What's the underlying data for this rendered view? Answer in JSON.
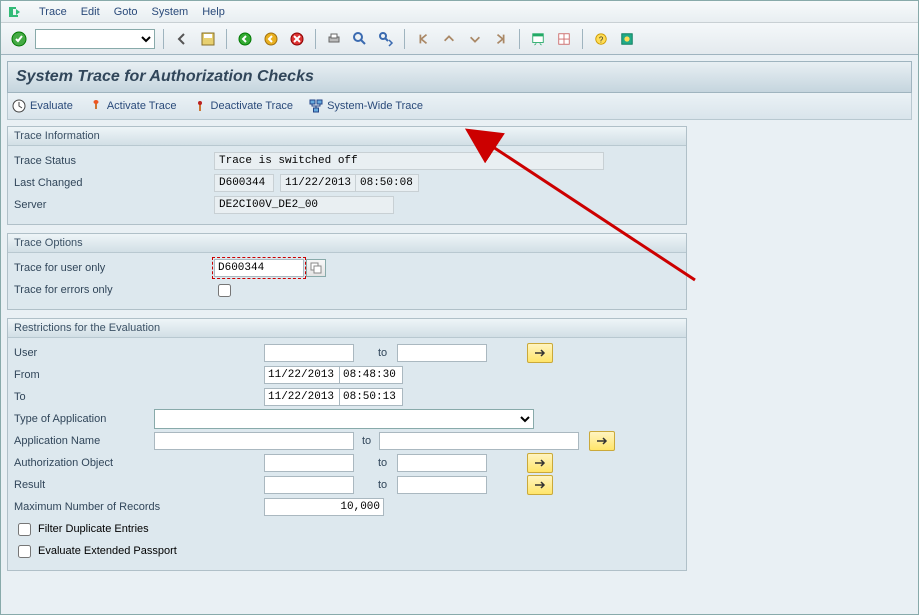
{
  "menu": {
    "items": [
      "Trace",
      "Edit",
      "Goto",
      "System",
      "Help"
    ]
  },
  "title": "System Trace for Authorization Checks",
  "app_toolbar": {
    "evaluate": "Evaluate",
    "activate": "Activate Trace",
    "deactivate": "Deactivate Trace",
    "system_wide": "System-Wide Trace"
  },
  "trace_info": {
    "title": "Trace Information",
    "status_lbl": "Trace Status",
    "status_val": "Trace is switched off",
    "lastch_lbl": "Last Changed",
    "lastch_user": "D600344",
    "lastch_date": "11/22/2013",
    "lastch_time": "08:50:08",
    "server_lbl": "Server",
    "server_val": "DE2CI00V_DE2_00"
  },
  "trace_opts": {
    "title": "Trace Options",
    "user_lbl": "Trace for user only",
    "user_val": "D600344",
    "errors_lbl": "Trace for errors only"
  },
  "restrict": {
    "title": "Restrictions for the Evaluation",
    "user": "User",
    "from": "From",
    "from_date": "11/22/2013",
    "from_time": "08:48:30",
    "to_lbl": "To",
    "to_date": "11/22/2013",
    "to_time": "08:50:13",
    "apptype": "Type of Application",
    "appname": "Application Name",
    "authobj": "Authorization Object",
    "result": "Result",
    "maxrec": "Maximum Number of Records",
    "maxrec_val": "10,000",
    "filter": "Filter Duplicate Entries",
    "passport": "Evaluate Extended Passport",
    "to": "to"
  }
}
